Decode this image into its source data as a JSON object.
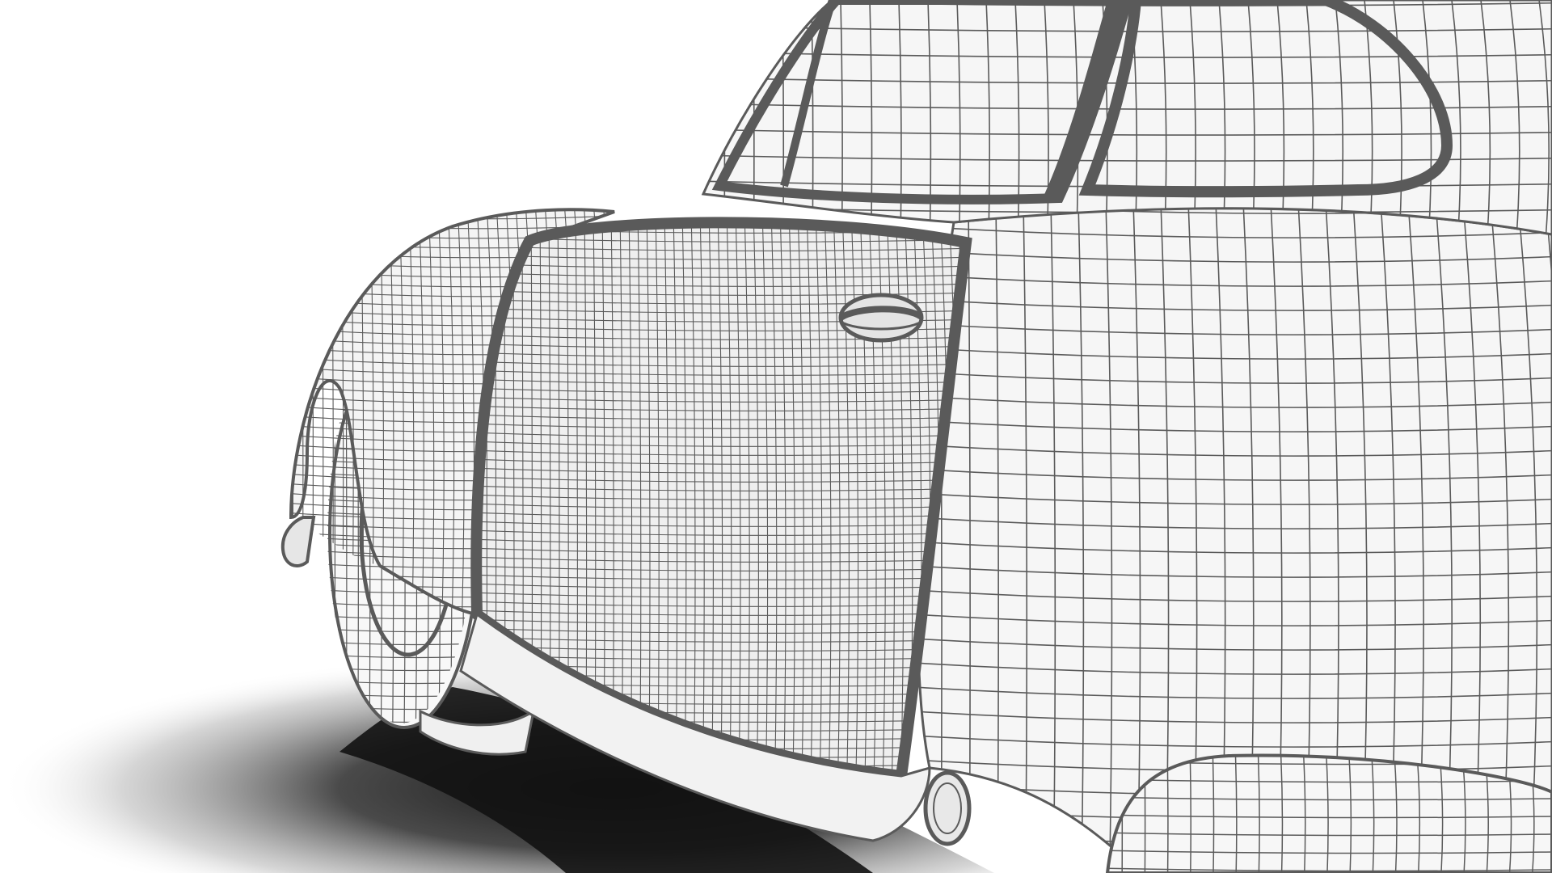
{
  "scene": {
    "subject": "car-wireframe-render",
    "colors": {
      "background": "#ffffff",
      "wire": "#5a5a5a",
      "panel_fill": "#f4f4f4",
      "shadow": "#141414"
    }
  }
}
